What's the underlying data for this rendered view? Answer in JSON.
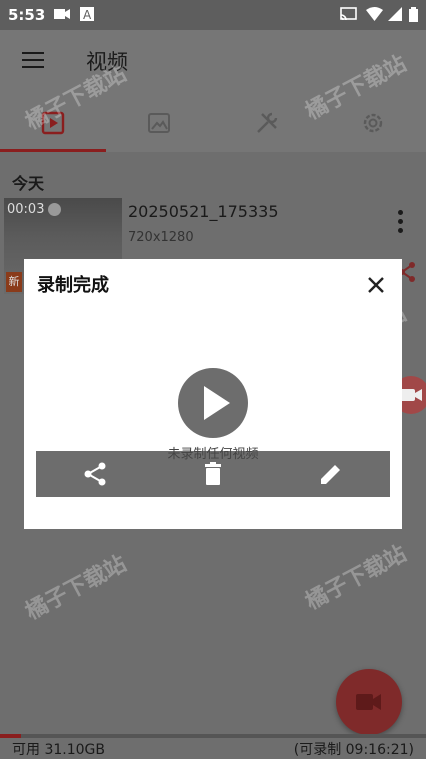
{
  "status_bar": {
    "time": "5:53",
    "left_icons": [
      "video-camera-icon",
      "text-a-icon"
    ],
    "right_icons": [
      "cast-icon",
      "wifi-icon",
      "signal-icon",
      "battery-icon"
    ]
  },
  "app_bar": {
    "title": "视频",
    "menu_icon": "hamburger-menu-icon"
  },
  "tabs": [
    {
      "name": "video",
      "icon": "video-tab-icon",
      "selected": true
    },
    {
      "name": "image",
      "icon": "image-tab-icon",
      "selected": false
    },
    {
      "name": "tools",
      "icon": "tools-tab-icon",
      "selected": false
    },
    {
      "name": "settings",
      "icon": "gear-icon",
      "selected": false
    }
  ],
  "section": {
    "label": "今天"
  },
  "video_item": {
    "duration": "00:03",
    "badge": "新",
    "name": "20250521_175335",
    "resolution": "720x1280"
  },
  "dialog": {
    "title": "录制完成",
    "empty_text": "未录制任何视频",
    "actions": [
      "share-icon",
      "delete-icon",
      "edit-icon"
    ]
  },
  "footer": {
    "available": "可用 31.10GB",
    "record_time": "(可录制 09:16:21)",
    "storage_used_fraction": 0.05
  },
  "watermark": "橘子下载站",
  "colors": {
    "accent": "#8a1e1e",
    "fab": "#7f2a2a",
    "dialog_bg": "#ffffff",
    "action_bar": "#6d6d6d"
  }
}
